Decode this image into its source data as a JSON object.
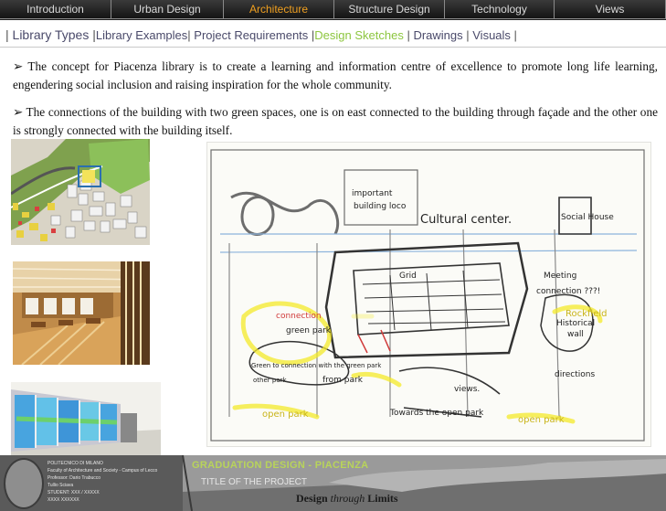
{
  "nav": {
    "tabs": [
      {
        "label": "Introduction"
      },
      {
        "label": "Urban Design"
      },
      {
        "label": "Architecture"
      },
      {
        "label": "Structure Design"
      },
      {
        "label": "Technology"
      },
      {
        "label": "Views"
      }
    ],
    "active_tab": "Architecture",
    "active_color": "#f0a020"
  },
  "subnav": {
    "items": [
      {
        "label": "Library Types"
      },
      {
        "label": "Library Examples"
      },
      {
        "label": "Project Requirements"
      },
      {
        "label": "Design Sketches"
      },
      {
        "label": "Drawings"
      },
      {
        "label": "Visuals"
      }
    ],
    "active_item": "Design Sketches",
    "active_color": "#8dc63f"
  },
  "content": {
    "bullet_icon": "arrow-bullet-icon",
    "paragraphs": [
      "The concept for Piacenza library is to create a learning and information centre of excellence to promote long life learning, engendering social inclusion and raising inspiration for the whole community.",
      "The connections of the building with two green spaces, one is on east connected to the building through façade and the other one is strongly connected with the building itself."
    ]
  },
  "sketch": {
    "annotations": {
      "cultural_center": "Cultural center.",
      "social_house": "Social House",
      "meeting": "Meeting",
      "connection": "connection ???!",
      "rockfield": "Rockfield",
      "historical": "Historical",
      "wall": "wall",
      "connection_red": "connection",
      "green_park": "green park",
      "from_park": "from park",
      "views": "views.",
      "towards": "Towards the open park",
      "open_park_left": "open park",
      "open_park_right": "open park",
      "important_building": "important",
      "build_sub": "building loco",
      "grid_note": "Grid",
      "direction": "directions",
      "green_note": "Green to connection with the green park",
      "other_park": "other park"
    }
  },
  "footer": {
    "university_lines": [
      "POLITECNICO DI MILANO",
      "Faculty of Architecture and Society - Campus of Lecco",
      "Professor: Dario Trabucco",
      "Tullio Sciava",
      "STUDENT: XXX / XXXXX",
      "XXXX XXXXXX"
    ],
    "graduation_title": "GRADUATION DESIGN - PIACENZA",
    "project_title": "TITLE OF THE PROJECT",
    "motto_a": "Design",
    "motto_b": "through",
    "motto_c": "Limits"
  }
}
